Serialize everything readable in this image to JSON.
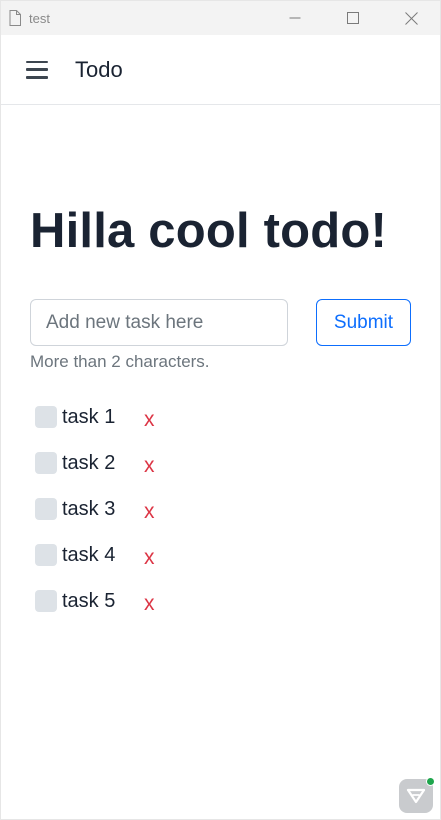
{
  "window": {
    "title": "test"
  },
  "header": {
    "app_title": "Todo"
  },
  "main": {
    "heading": "Hilla cool todo!",
    "input": {
      "placeholder": "Add new task here",
      "value": ""
    },
    "submit_label": "Submit",
    "hint": "More than 2 characters.",
    "tasks": [
      {
        "label": "task 1",
        "delete_label": "x",
        "checked": false
      },
      {
        "label": "task 2",
        "delete_label": "x",
        "checked": false
      },
      {
        "label": "task 3",
        "delete_label": "x",
        "checked": false
      },
      {
        "label": "task 4",
        "delete_label": "x",
        "checked": false
      },
      {
        "label": "task 5",
        "delete_label": "x",
        "checked": false
      }
    ]
  },
  "colors": {
    "accent": "#0d6efd",
    "danger": "#dc3545",
    "text": "#1a2332",
    "muted": "#6c757d",
    "status_online": "#1ea54c"
  },
  "icons": {
    "file": "file-icon",
    "minimize": "minimize-icon",
    "maximize": "maximize-icon",
    "close": "close-icon",
    "menu": "hamburger-menu-icon",
    "dev_tools": "dev-tools-icon"
  }
}
